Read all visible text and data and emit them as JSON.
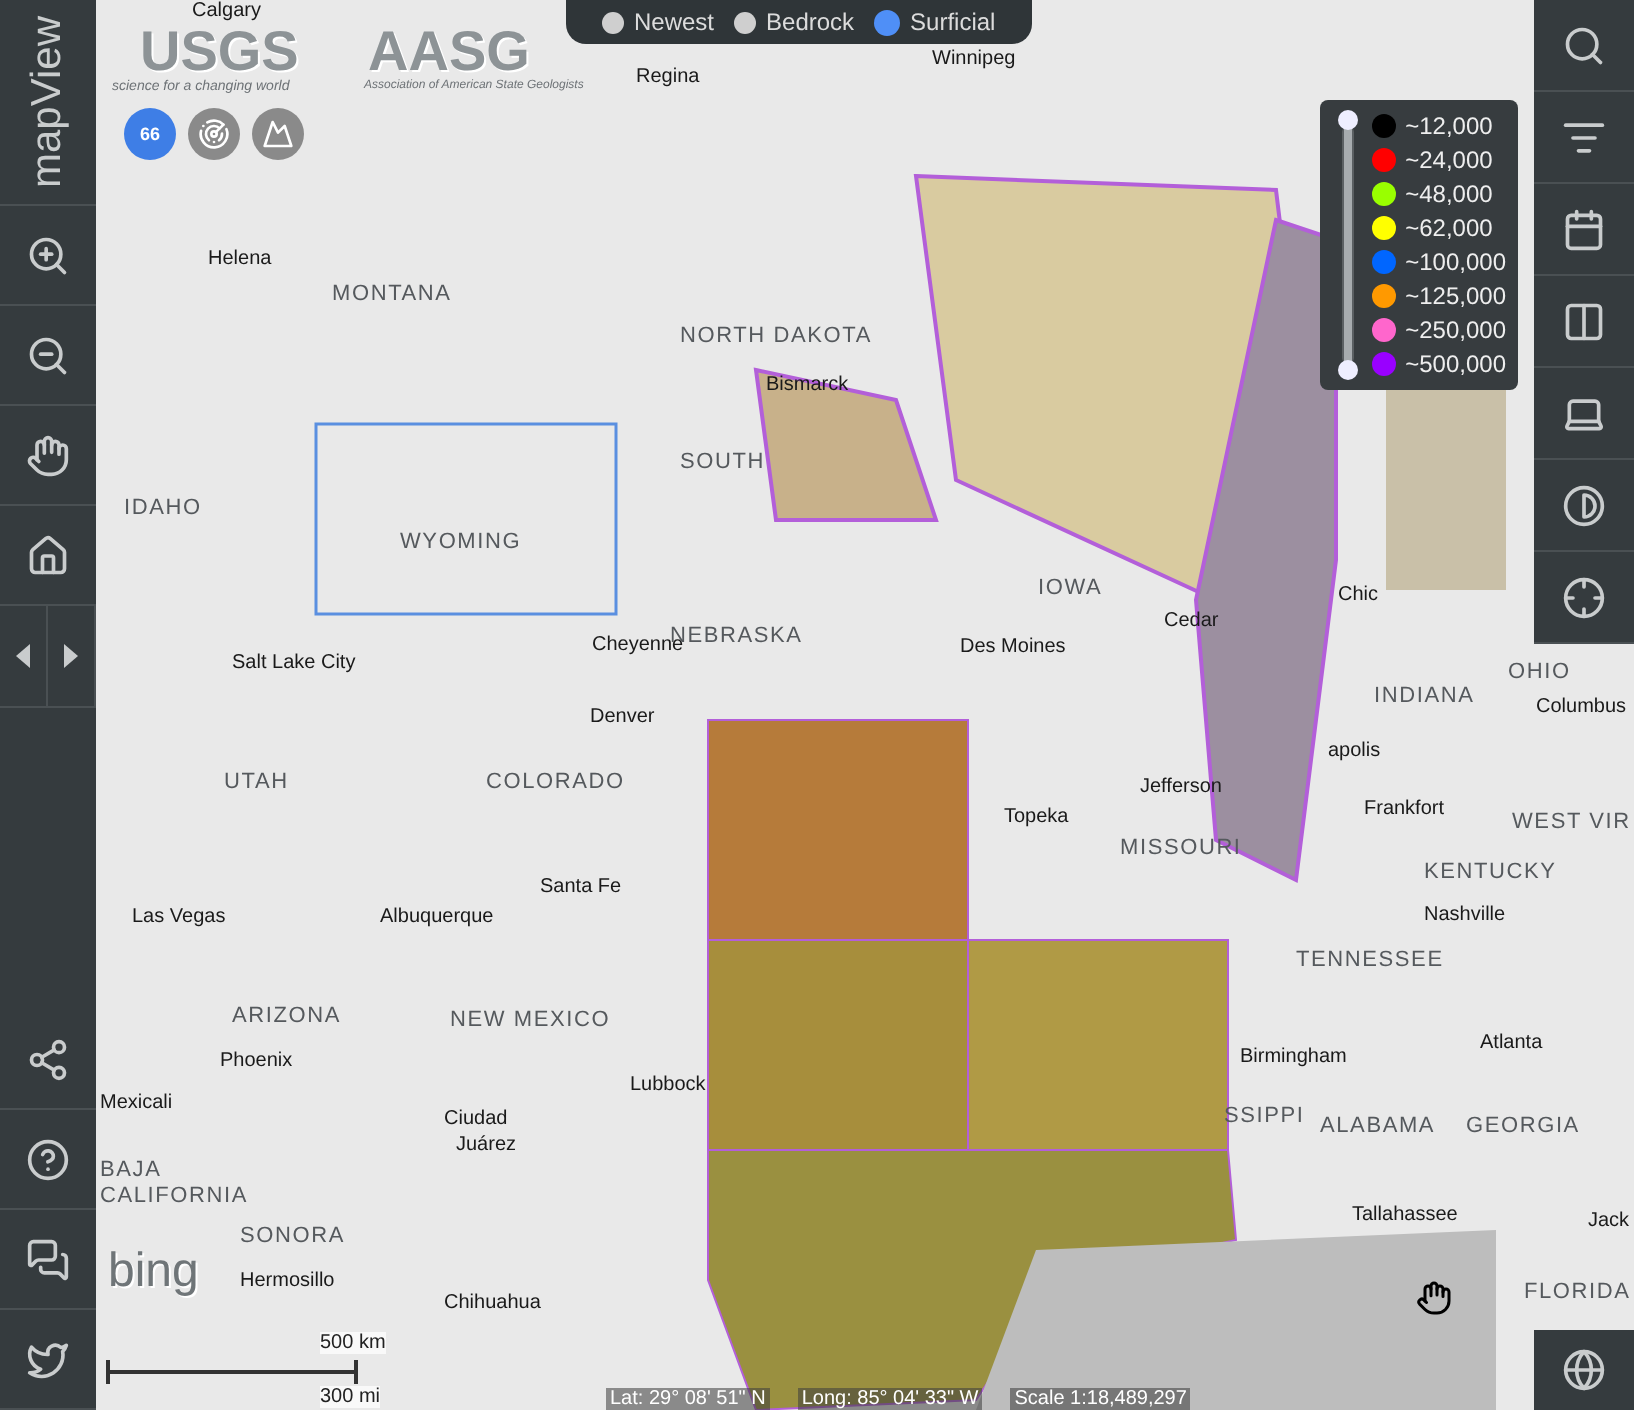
{
  "app": {
    "title": "mapView"
  },
  "logos": {
    "usgs": "USGS",
    "usgs_tagline": "science for a changing world",
    "aasg": "AASG",
    "aasg_tagline": "Association of American State Geologists"
  },
  "base_layers": [
    {
      "label": "Newest",
      "selected": false
    },
    {
      "label": "Bedrock",
      "selected": false
    },
    {
      "label": "Surficial",
      "selected": true
    }
  ],
  "shield": "66",
  "legend_slider": {
    "level": 1
  },
  "legend": [
    {
      "label": "~12,000",
      "color": "#000000"
    },
    {
      "label": "~24,000",
      "color": "#ff0000"
    },
    {
      "label": "~48,000",
      "color": "#99ff00"
    },
    {
      "label": "~62,000",
      "color": "#ffff00"
    },
    {
      "label": "~100,000",
      "color": "#0066ff"
    },
    {
      "label": "~125,000",
      "color": "#ff9900"
    },
    {
      "label": "~250,000",
      "color": "#ff66cc"
    },
    {
      "label": "~500,000",
      "color": "#9900ff"
    }
  ],
  "places": [
    {
      "name": "Calgary",
      "kind": "city"
    },
    {
      "name": "Regina",
      "kind": "city"
    },
    {
      "name": "Winnipeg",
      "kind": "city"
    },
    {
      "name": "Helena",
      "kind": "city"
    },
    {
      "name": "MONTANA",
      "kind": "state"
    },
    {
      "name": "NORTH DAKOTA",
      "kind": "state"
    },
    {
      "name": "Bismarck",
      "kind": "city"
    },
    {
      "name": "SOUTH",
      "kind": "state"
    },
    {
      "name": "IDAHO",
      "kind": "state"
    },
    {
      "name": "WYOMING",
      "kind": "state"
    },
    {
      "name": "Salt Lake City",
      "kind": "city"
    },
    {
      "name": "Cheyenne",
      "kind": "city"
    },
    {
      "name": "NEBRASKA",
      "kind": "state"
    },
    {
      "name": "IOWA",
      "kind": "state"
    },
    {
      "name": "Des Moines",
      "kind": "city"
    },
    {
      "name": "Cedar",
      "kind": "city"
    },
    {
      "name": "Chic",
      "kind": "city"
    },
    {
      "name": "Denver",
      "kind": "city"
    },
    {
      "name": "UTAH",
      "kind": "state"
    },
    {
      "name": "COLORADO",
      "kind": "state"
    },
    {
      "name": "Topeka",
      "kind": "city"
    },
    {
      "name": "INDIANA",
      "kind": "state"
    },
    {
      "name": "OHIO",
      "kind": "state"
    },
    {
      "name": "Columbus",
      "kind": "city"
    },
    {
      "name": "apolis",
      "kind": "city"
    },
    {
      "name": "Jefferson",
      "kind": "city"
    },
    {
      "name": "Frankfort",
      "kind": "city"
    },
    {
      "name": "WEST VIR",
      "kind": "state"
    },
    {
      "name": "MISSOURI",
      "kind": "state"
    },
    {
      "name": "KENTUCKY",
      "kind": "state"
    },
    {
      "name": "Las Vegas",
      "kind": "city"
    },
    {
      "name": "Santa Fe",
      "kind": "city"
    },
    {
      "name": "Albuquerque",
      "kind": "city"
    },
    {
      "name": "Nashville",
      "kind": "city"
    },
    {
      "name": "TENNESSEE",
      "kind": "state"
    },
    {
      "name": "ARIZONA",
      "kind": "state"
    },
    {
      "name": "NEW MEXICO",
      "kind": "state"
    },
    {
      "name": "Phoenix",
      "kind": "city"
    },
    {
      "name": "Lubbock",
      "kind": "city"
    },
    {
      "name": "Birmingham",
      "kind": "city"
    },
    {
      "name": "Atlanta",
      "kind": "city"
    },
    {
      "name": "Mexicali",
      "kind": "city"
    },
    {
      "name": "Ciudad",
      "kind": "city"
    },
    {
      "name": "Juárez",
      "kind": "city"
    },
    {
      "name": "SSIPPI",
      "kind": "state"
    },
    {
      "name": "ALABAMA",
      "kind": "state"
    },
    {
      "name": "GEORGIA",
      "kind": "state"
    },
    {
      "name": "BAJA",
      "kind": "state"
    },
    {
      "name": "CALIFORNIA",
      "kind": "state"
    },
    {
      "name": "SONORA",
      "kind": "state"
    },
    {
      "name": "Tallahassee",
      "kind": "city"
    },
    {
      "name": "Jack",
      "kind": "city"
    },
    {
      "name": "Hermosillo",
      "kind": "city"
    },
    {
      "name": "Chihuahua",
      "kind": "city"
    },
    {
      "name": "FLORIDA",
      "kind": "state"
    }
  ],
  "bing": "bing",
  "scale_bar": {
    "km": "500 km",
    "mi": "300 mi"
  },
  "status": {
    "lat": "Lat: 29° 08' 51\" N",
    "long": "Long: 85° 04' 33\" W",
    "scale": "Scale 1:18,489,297"
  }
}
